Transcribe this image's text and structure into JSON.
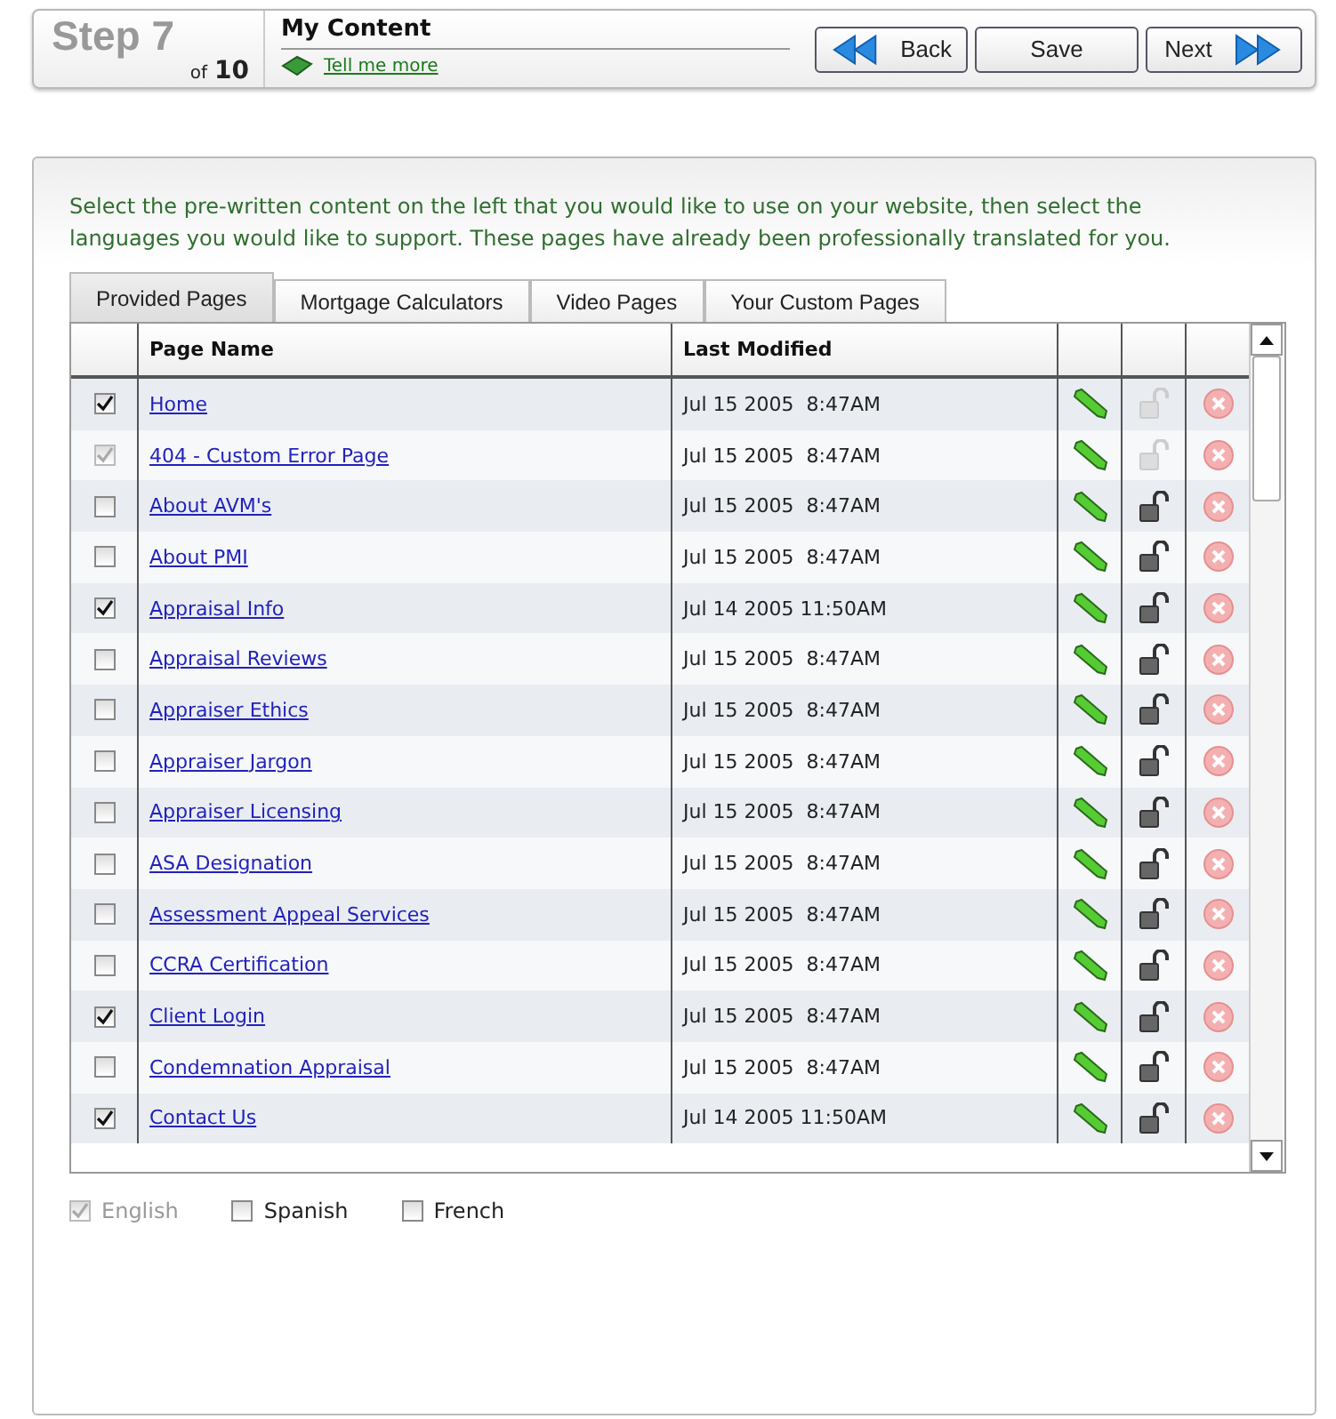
{
  "header": {
    "step_label": "Step 7",
    "step_of": "of",
    "step_total": "10",
    "title": "My Content",
    "help_link": "Tell me more",
    "buttons": [
      {
        "kind": "back",
        "label": "Back"
      },
      {
        "kind": "save",
        "label": "Save"
      },
      {
        "kind": "next",
        "label": "Next"
      }
    ]
  },
  "instructions": "Select the pre-written content on the left that you would like to use on your website, then select the languages you would like to support.  These pages have already been professionally translated for you.",
  "tabs": [
    {
      "label": "Provided Pages",
      "selected": true
    },
    {
      "label": "Mortgage Calculators",
      "selected": false
    },
    {
      "label": "Video Pages",
      "selected": false
    },
    {
      "label": "Your Custom Pages",
      "selected": false
    }
  ],
  "table": {
    "columns": [
      "Page Name",
      "Last Modified"
    ],
    "rows": [
      {
        "name": "Home",
        "modified": "Jul 15 2005  8:47AM",
        "checked": true,
        "disabled": false,
        "lock_disabled": true
      },
      {
        "name": "404 - Custom Error Page",
        "modified": "Jul 15 2005  8:47AM",
        "checked": true,
        "disabled": true,
        "lock_disabled": true
      },
      {
        "name": "About AVM's",
        "modified": "Jul 15 2005  8:47AM",
        "checked": false,
        "disabled": false,
        "lock_disabled": false
      },
      {
        "name": "About PMI",
        "modified": "Jul 15 2005  8:47AM",
        "checked": false,
        "disabled": false,
        "lock_disabled": false
      },
      {
        "name": "Appraisal Info",
        "modified": "Jul 14 2005 11:50AM",
        "checked": true,
        "disabled": false,
        "lock_disabled": false
      },
      {
        "name": "Appraisal Reviews",
        "modified": "Jul 15 2005  8:47AM",
        "checked": false,
        "disabled": false,
        "lock_disabled": false
      },
      {
        "name": "Appraiser Ethics",
        "modified": "Jul 15 2005  8:47AM",
        "checked": false,
        "disabled": false,
        "lock_disabled": false
      },
      {
        "name": "Appraiser Jargon",
        "modified": "Jul 15 2005  8:47AM",
        "checked": false,
        "disabled": false,
        "lock_disabled": false
      },
      {
        "name": "Appraiser Licensing",
        "modified": "Jul 15 2005  8:47AM",
        "checked": false,
        "disabled": false,
        "lock_disabled": false
      },
      {
        "name": "ASA Designation",
        "modified": "Jul 15 2005  8:47AM",
        "checked": false,
        "disabled": false,
        "lock_disabled": false
      },
      {
        "name": "Assessment Appeal Services",
        "modified": "Jul 15 2005  8:47AM",
        "checked": false,
        "disabled": false,
        "lock_disabled": false
      },
      {
        "name": "CCRA Certification",
        "modified": "Jul 15 2005  8:47AM",
        "checked": false,
        "disabled": false,
        "lock_disabled": false
      },
      {
        "name": "Client Login",
        "modified": "Jul 15 2005  8:47AM",
        "checked": true,
        "disabled": false,
        "lock_disabled": false
      },
      {
        "name": "Condemnation Appraisal",
        "modified": "Jul 15 2005  8:47AM",
        "checked": false,
        "disabled": false,
        "lock_disabled": false
      },
      {
        "name": "Contact Us",
        "modified": "Jul 14 2005 11:50AM",
        "checked": true,
        "disabled": false,
        "lock_disabled": false
      }
    ]
  },
  "languages": [
    {
      "label": "English",
      "checked": true,
      "disabled": true
    },
    {
      "label": "Spanish",
      "checked": false,
      "disabled": false
    },
    {
      "label": "French",
      "checked": false,
      "disabled": false
    }
  ]
}
